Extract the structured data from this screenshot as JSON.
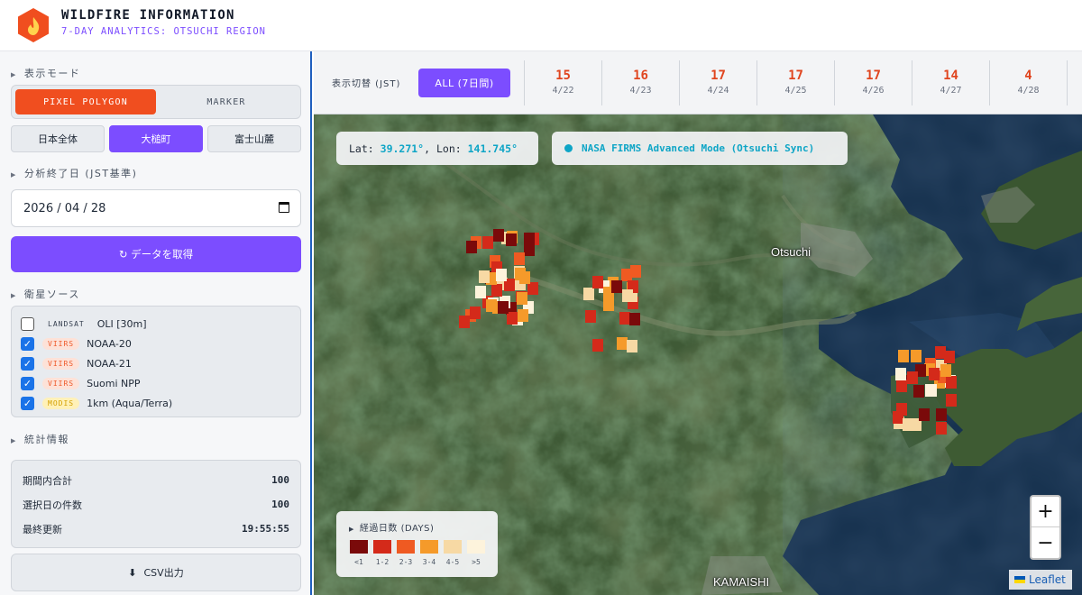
{
  "header": {
    "title": "WILDFIRE INFORMATION",
    "subtitle": "7-DAY ANALYTICS: OTSUCHI REGION",
    "logo_icon": "fire-icon",
    "accent": "#f04e1f"
  },
  "sidebar": {
    "display_mode": {
      "heading": "表示モード",
      "options": [
        "PIXEL POLYGON",
        "MARKER"
      ],
      "selected": "PIXEL POLYGON"
    },
    "regions": [
      "日本全体",
      "大槌町",
      "富士山麓"
    ],
    "selected_region": "大槌町",
    "end_date": {
      "heading": "分析終了日 (JST基準)",
      "value": "2026 / 04 / 28"
    },
    "fetch_button": "↻ データを取得",
    "satellites": {
      "heading": "衛星ソース",
      "items": [
        {
          "tag": "LANDSAT",
          "label": "OLI [30m]",
          "checked": false
        },
        {
          "tag": "VIIRS",
          "label": "NOAA-20",
          "checked": true
        },
        {
          "tag": "VIIRS",
          "label": "NOAA-21",
          "checked": true
        },
        {
          "tag": "VIIRS",
          "label": "Suomi NPP",
          "checked": true
        },
        {
          "tag": "MODIS",
          "label": "1km (Aqua/Terra)",
          "checked": true
        }
      ]
    },
    "stats": {
      "heading": "統計情報",
      "rows": [
        {
          "label": "期間内合計",
          "value": "100"
        },
        {
          "label": "選択日の件数",
          "value": "100"
        },
        {
          "label": "最終更新",
          "value": "19:55:55"
        }
      ]
    },
    "csv_button": "CSV出力"
  },
  "map": {
    "date_bar": {
      "label": "表示切替 (JST)",
      "all_button": "ALL (7日間)",
      "days": [
        {
          "count": "15",
          "date": "4/22"
        },
        {
          "count": "16",
          "date": "4/23"
        },
        {
          "count": "17",
          "date": "4/24"
        },
        {
          "count": "17",
          "date": "4/25"
        },
        {
          "count": "17",
          "date": "4/26"
        },
        {
          "count": "14",
          "date": "4/27"
        },
        {
          "count": "4",
          "date": "4/28"
        }
      ]
    },
    "coords": {
      "lat_label": "Lat:",
      "lat": "39.271°",
      "lon_label": "Lon:",
      "lon": "141.745°"
    },
    "firms_status": "NASA FIRMS Advanced Mode (Otsuchi Sync)",
    "places": [
      "Otsuchi",
      "KAMAISHI"
    ],
    "legend": {
      "title": "経過日数 (DAYS)",
      "items": [
        {
          "label": "<1",
          "color": "#7a0a0a"
        },
        {
          "label": "1-2",
          "color": "#d42a1a"
        },
        {
          "label": "2-3",
          "color": "#ef5a22"
        },
        {
          "label": "3-4",
          "color": "#f59a2a"
        },
        {
          "label": "4-5",
          "color": "#f7d9a4"
        },
        {
          "label": ">5",
          "color": "#fdf3dc"
        }
      ]
    },
    "zoom_in": "+",
    "zoom_out": "−",
    "attribution": "Leaflet"
  }
}
